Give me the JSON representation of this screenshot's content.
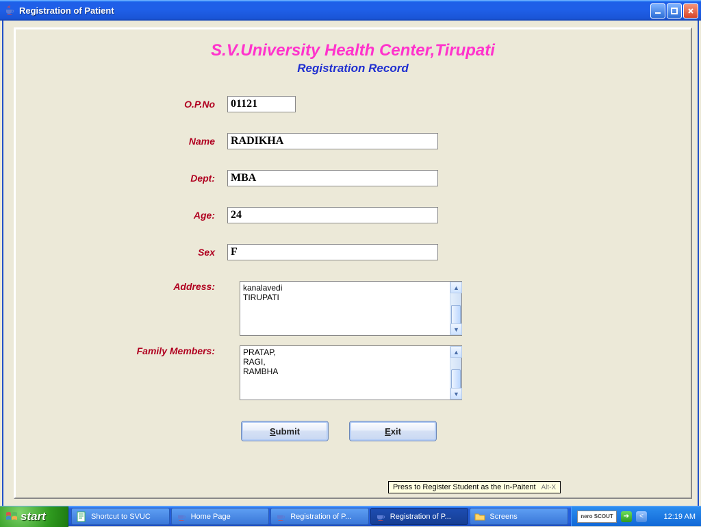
{
  "window": {
    "title": "Registration of Patient"
  },
  "heading": {
    "org": "S.V.University Health Center,Tirupati",
    "sub": "Registration Record"
  },
  "labels": {
    "opno": "O.P.No",
    "name": "Name",
    "dept": "Dept:",
    "age": "Age:",
    "sex": "Sex",
    "address": "Address:",
    "family": "Family Members:"
  },
  "fields": {
    "opno": "01121",
    "name": "RADIKHA",
    "dept": "MBA",
    "age": "24",
    "sex": "F",
    "address": "kanalavedi\nTIRUPATI",
    "family": "PRATAP,\nRAGI,\nRAMBHA"
  },
  "buttons": {
    "submit_prefix": "S",
    "submit_rest": "ubmit",
    "exit_prefix": "E",
    "exit_rest": "xit"
  },
  "tooltip": {
    "text": "Press to Register Student as the In-Paitent",
    "shortcut": "Alt-X"
  },
  "taskbar": {
    "start": "start",
    "items": [
      {
        "label": "Shortcut to SVUC",
        "icon": "shortcut",
        "active": false
      },
      {
        "label": "Home Page",
        "icon": "java",
        "active": false
      },
      {
        "label": "Registration of P...",
        "icon": "java",
        "active": false
      },
      {
        "label": "Registration of P...",
        "icon": "java",
        "active": true
      },
      {
        "label": "Screens",
        "icon": "folder",
        "active": false
      }
    ],
    "tray_brand": "nero SCOUT",
    "clock": "12:19 AM"
  }
}
